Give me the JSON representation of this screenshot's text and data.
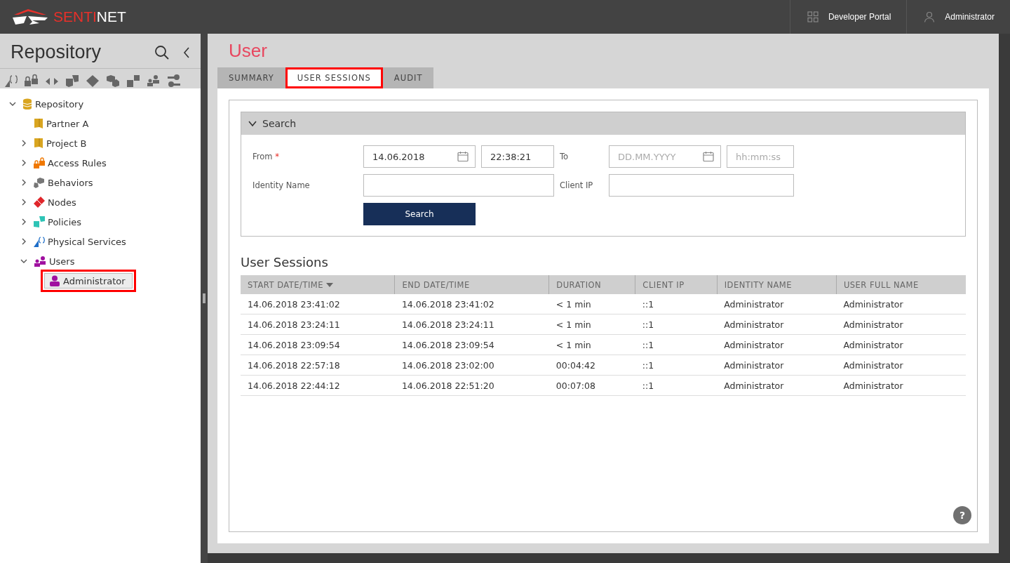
{
  "header": {
    "logo": {
      "accent": "SENTI",
      "rest": "NET"
    },
    "links": [
      {
        "kind": "grid",
        "label": "Developer Portal"
      },
      {
        "kind": "user",
        "label": "Administrator"
      }
    ]
  },
  "sidebar": {
    "title": "Repository",
    "tree": [
      {
        "label": "Repository",
        "kind": "database",
        "expanded": true,
        "children": [
          {
            "label": "Partner A",
            "kind": "folder"
          },
          {
            "label": "Project B",
            "kind": "folder",
            "expanded": false
          },
          {
            "label": "Access Rules",
            "kind": "lock",
            "expanded": false
          },
          {
            "label": "Behaviors",
            "kind": "cubes",
            "expanded": false
          },
          {
            "label": "Nodes",
            "kind": "diamond",
            "expanded": false
          },
          {
            "label": "Policies",
            "kind": "policy",
            "expanded": false
          },
          {
            "label": "Physical Services",
            "kind": "service",
            "expanded": false
          },
          {
            "label": "Users",
            "kind": "users",
            "expanded": true,
            "children": [
              {
                "label": "Administrator",
                "kind": "user",
                "selected": true,
                "highlighted": true
              }
            ]
          }
        ]
      }
    ]
  },
  "page": {
    "title": "User",
    "tabs": [
      {
        "label": "SUMMARY",
        "selected": false,
        "highlighted": false
      },
      {
        "label": "USER SESSIONS",
        "selected": true,
        "highlighted": true
      },
      {
        "label": "AUDIT",
        "selected": false,
        "highlighted": false
      }
    ],
    "search": {
      "title": "Search",
      "expanded": true,
      "from": {
        "label": "From",
        "required": true,
        "required_mark": "*",
        "date": "14.06.2018",
        "time": "22:38:21"
      },
      "to": {
        "label": "To",
        "date_placeholder": "DD.MM.YYYY",
        "time_placeholder": "hh:mm:ss"
      },
      "identity_name": {
        "label": "Identity Name"
      },
      "client_ip": {
        "label": "Client IP"
      },
      "button": "Search"
    },
    "sessions": {
      "title": "User Sessions",
      "columns": [
        {
          "label": "START DATE/TIME",
          "sorted": true
        },
        {
          "label": "END DATE/TIME",
          "sorted": false
        },
        {
          "label": "DURATION",
          "sorted": false
        },
        {
          "label": "CLIENT IP",
          "sorted": false
        },
        {
          "label": "IDENTITY NAME",
          "sorted": false
        },
        {
          "label": "USER FULL NAME",
          "sorted": false
        }
      ],
      "rows": [
        [
          "14.06.2018 23:41:02",
          "14.06.2018 23:41:02",
          "< 1 min",
          "::1",
          "Administrator",
          "Administrator"
        ],
        [
          "14.06.2018 23:24:11",
          "14.06.2018 23:24:11",
          "< 1 min",
          "::1",
          "Administrator",
          "Administrator"
        ],
        [
          "14.06.2018 23:09:54",
          "14.06.2018 23:09:54",
          "< 1 min",
          "::1",
          "Administrator",
          "Administrator"
        ],
        [
          "14.06.2018 22:57:18",
          "14.06.2018 23:02:00",
          "00:04:42",
          "::1",
          "Administrator",
          "Administrator"
        ],
        [
          "14.06.2018 22:44:12",
          "14.06.2018 22:51:20",
          "00:07:08",
          "::1",
          "Administrator",
          "Administrator"
        ]
      ]
    },
    "help": "?"
  }
}
